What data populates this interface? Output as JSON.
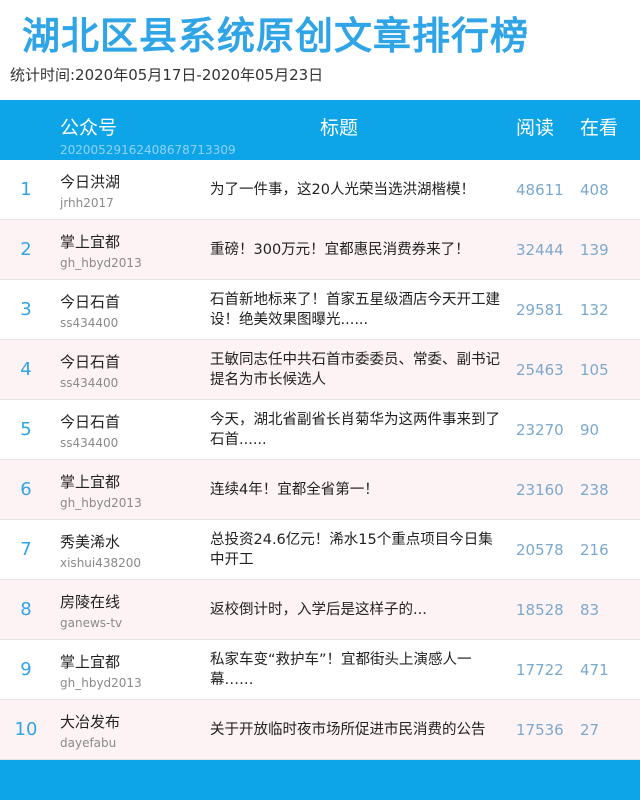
{
  "page": {
    "title": "湖北区县系统原创文章排行榜",
    "period": "统计时间:2020年05月17日-2020年05月23日"
  },
  "header": {
    "account": "公众号",
    "code": "20200529162408678713309",
    "title": "标题",
    "reads": "阅读",
    "likes": "在看"
  },
  "colors": {
    "accent": "#0ea4e8",
    "title": "#2fa4e7",
    "row_alt": "#fdf2f4",
    "numbers": "#7ba8cf"
  },
  "rows": [
    {
      "rank": "1",
      "account": "今日洪湖",
      "account_id": "jrhh2017",
      "title": "为了一件事，这20人光荣当选洪湖楷模！",
      "reads": "48611",
      "likes": "408"
    },
    {
      "rank": "2",
      "account": "掌上宜都",
      "account_id": "gh_hbyd2013",
      "title": "重磅！300万元！宜都惠民消费券来了！",
      "reads": "32444",
      "likes": "139"
    },
    {
      "rank": "3",
      "account": "今日石首",
      "account_id": "ss434400",
      "title": "石首新地标来了！首家五星级酒店今天开工建设！绝美效果图曝光......",
      "reads": "29581",
      "likes": "132"
    },
    {
      "rank": "4",
      "account": "今日石首",
      "account_id": "ss434400",
      "title": "王敏同志任中共石首市委委员、常委、副书记 提名为市长候选人",
      "reads": "25463",
      "likes": "105"
    },
    {
      "rank": "5",
      "account": "今日石首",
      "account_id": "ss434400",
      "title": "今天，湖北省副省长肖菊华为这两件事来到了石首......",
      "reads": "23270",
      "likes": "90"
    },
    {
      "rank": "6",
      "account": "掌上宜都",
      "account_id": "gh_hbyd2013",
      "title": "连续4年！宜都全省第一！",
      "reads": "23160",
      "likes": "238"
    },
    {
      "rank": "7",
      "account": "秀美浠水",
      "account_id": "xishui438200",
      "title": "总投资24.6亿元！浠水15个重点项目今日集中开工",
      "reads": "20578",
      "likes": "216"
    },
    {
      "rank": "8",
      "account": "房陵在线",
      "account_id": "ganews-tv",
      "title": "返校倒计时，入学后是这样子的...",
      "reads": "18528",
      "likes": "83"
    },
    {
      "rank": "9",
      "account": "掌上宜都",
      "account_id": "gh_hbyd2013",
      "title": "私家车变“救护车”！宜都街头上演感人一幕……",
      "reads": "17722",
      "likes": "471"
    },
    {
      "rank": "10",
      "account": "大冶发布",
      "account_id": "dayefabu",
      "title": "关于开放临时夜市场所促进市民消费的公告",
      "reads": "17536",
      "likes": "27"
    }
  ]
}
